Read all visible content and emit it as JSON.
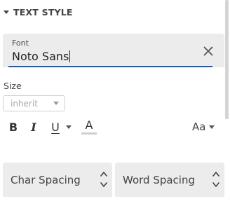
{
  "section": {
    "title": "TEXT STYLE"
  },
  "font": {
    "label": "Font",
    "value": "Noto Sans"
  },
  "size": {
    "label": "Size",
    "value": "inherit"
  },
  "format": {
    "bold": "B",
    "italic": "I",
    "underline": "U",
    "font_color": "A",
    "case": "Aa"
  },
  "spacing": {
    "char_label": "Char Spacing",
    "word_label": "Word Spacing"
  },
  "colors": {
    "accent": "#2b5797",
    "field_bg": "#ececec"
  },
  "icons": [
    "caret-down-icon",
    "close-icon",
    "chevron-up-down-icon",
    "dropdown-arrow-icon"
  ]
}
